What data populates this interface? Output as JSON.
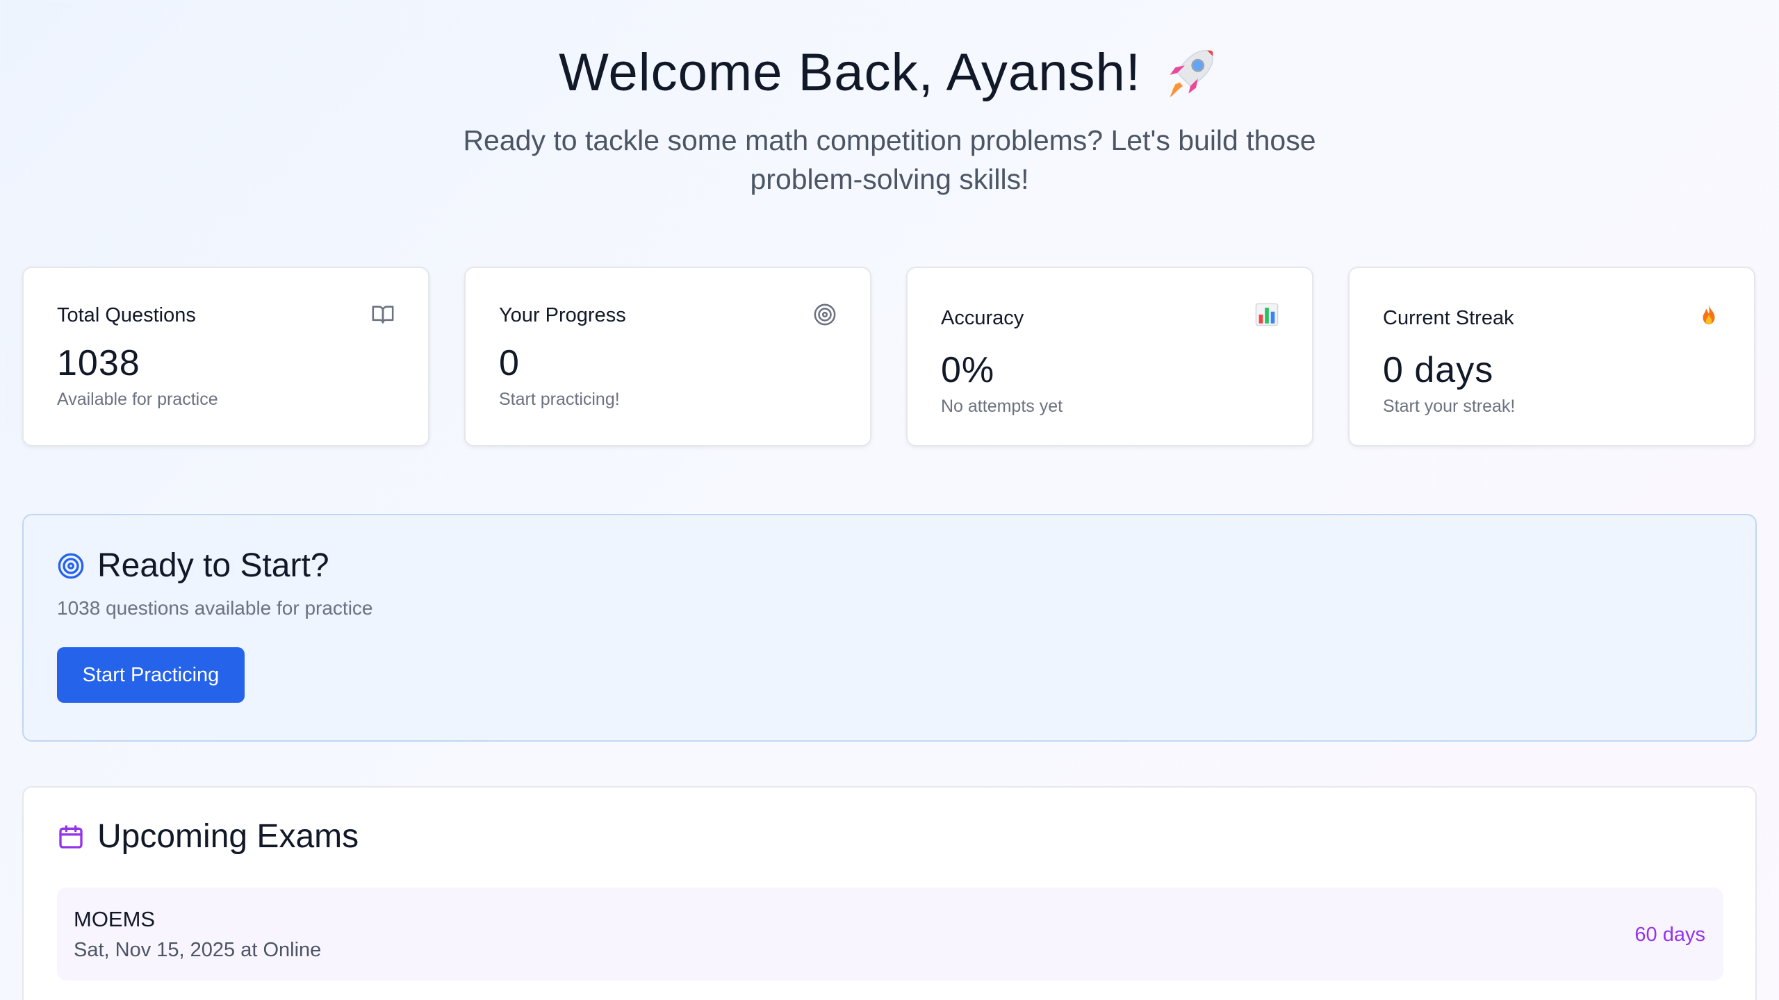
{
  "hero": {
    "title": "Welcome Back, Ayansh!",
    "title_emoji": "rocket-icon",
    "subtitle": "Ready to tackle some math competition problems? Let's build those problem-solving skills!"
  },
  "stats": [
    {
      "label": "Total Questions",
      "value": "1038",
      "sub": "Available for practice",
      "icon": "book-open-icon"
    },
    {
      "label": "Your Progress",
      "value": "0",
      "sub": "Start practicing!",
      "icon": "target-icon"
    },
    {
      "label": "Accuracy",
      "value": "0%",
      "sub": "No attempts yet",
      "icon": "bar-chart-icon"
    },
    {
      "label": "Current Streak",
      "value": "0 days",
      "sub": "Start your streak!",
      "icon": "fire-icon"
    }
  ],
  "ready": {
    "title": "Ready to Start?",
    "subtitle": "1038 questions available for practice",
    "button_label": "Start Practicing",
    "icon": "target-icon"
  },
  "exams": {
    "title": "Upcoming Exams",
    "icon": "calendar-icon",
    "items": [
      {
        "name": "MOEMS",
        "date": "Sat, Nov 15, 2025 at Online",
        "countdown": "60 days"
      }
    ]
  },
  "colors": {
    "primary": "#2563eb",
    "accent_purple": "#9333ea",
    "ready_bg": "#eef5ff",
    "exam_row_bg": "#f9f5fe"
  }
}
